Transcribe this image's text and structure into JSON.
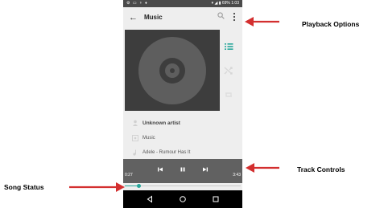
{
  "status_bar": {
    "left_icons": "⚙ ▭ ♆ ♦",
    "right_text": "▾ ◢ ▮ 69% 1:03"
  },
  "app_bar": {
    "title": "Music"
  },
  "track_info": {
    "artist": "Unknown artist",
    "album": "Music",
    "song": "Adele - Rumour Has It"
  },
  "controls": {
    "elapsed": "0:27",
    "duration": "3:43"
  },
  "progress": {
    "fraction": 0.12
  },
  "annotations": {
    "playback_options": "Playback Options",
    "track_controls": "Track Controls",
    "song_status": "Song Status"
  },
  "colors": {
    "accent": "#26a69a",
    "control_bar": "#616161",
    "status_bar": "#4a4a4a",
    "arrow": "#d32f2f"
  },
  "icons": [
    "back-arrow-icon",
    "search-icon",
    "more-vert-icon",
    "playlist-icon",
    "shuffle-icon",
    "repeat-icon",
    "artist-icon",
    "album-icon",
    "song-icon",
    "previous-icon",
    "pause-icon",
    "next-icon",
    "nav-back-icon",
    "nav-home-icon",
    "nav-recents-icon"
  ]
}
